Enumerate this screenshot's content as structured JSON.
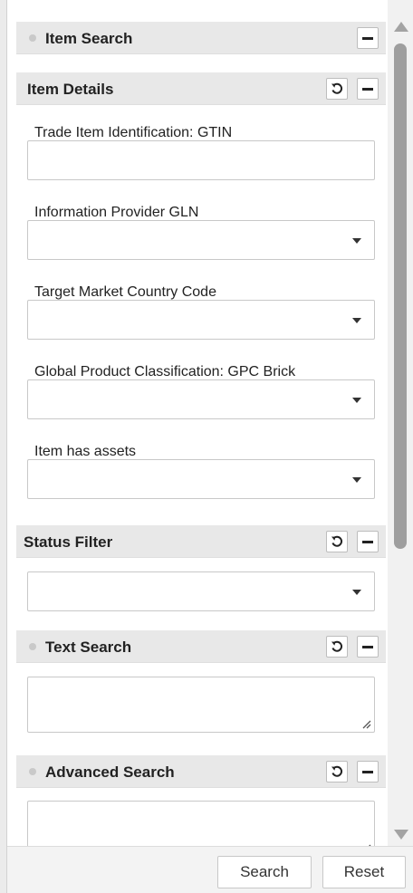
{
  "sections": {
    "item_search": {
      "title": "Item Search"
    },
    "item_details": {
      "title": "Item Details"
    },
    "status_filter": {
      "title": "Status Filter"
    },
    "text_search": {
      "title": "Text Search"
    },
    "advanced_search": {
      "title": "Advanced Search"
    }
  },
  "fields": {
    "gtin": {
      "label": "Trade Item Identification: GTIN",
      "value": ""
    },
    "gln": {
      "label": "Information Provider GLN",
      "value": ""
    },
    "country": {
      "label": "Target Market Country Code",
      "value": ""
    },
    "gpc": {
      "label": "Global Product Classification: GPC Brick",
      "value": ""
    },
    "assets": {
      "label": "Item has assets",
      "value": ""
    },
    "status": {
      "value": ""
    },
    "text_search": {
      "value": ""
    },
    "advanced_search": {
      "value": ""
    }
  },
  "buttons": {
    "search": "Search",
    "reset": "Reset"
  },
  "icons": {
    "collapse": "minus-icon",
    "reset": "refresh-icon",
    "dropdown": "chevron-down-icon",
    "status_dot": "dot-icon"
  },
  "colors": {
    "header_bg": "#e8e8e8",
    "border": "#c8c8c8",
    "scroll_thumb": "#9e9e9e"
  }
}
